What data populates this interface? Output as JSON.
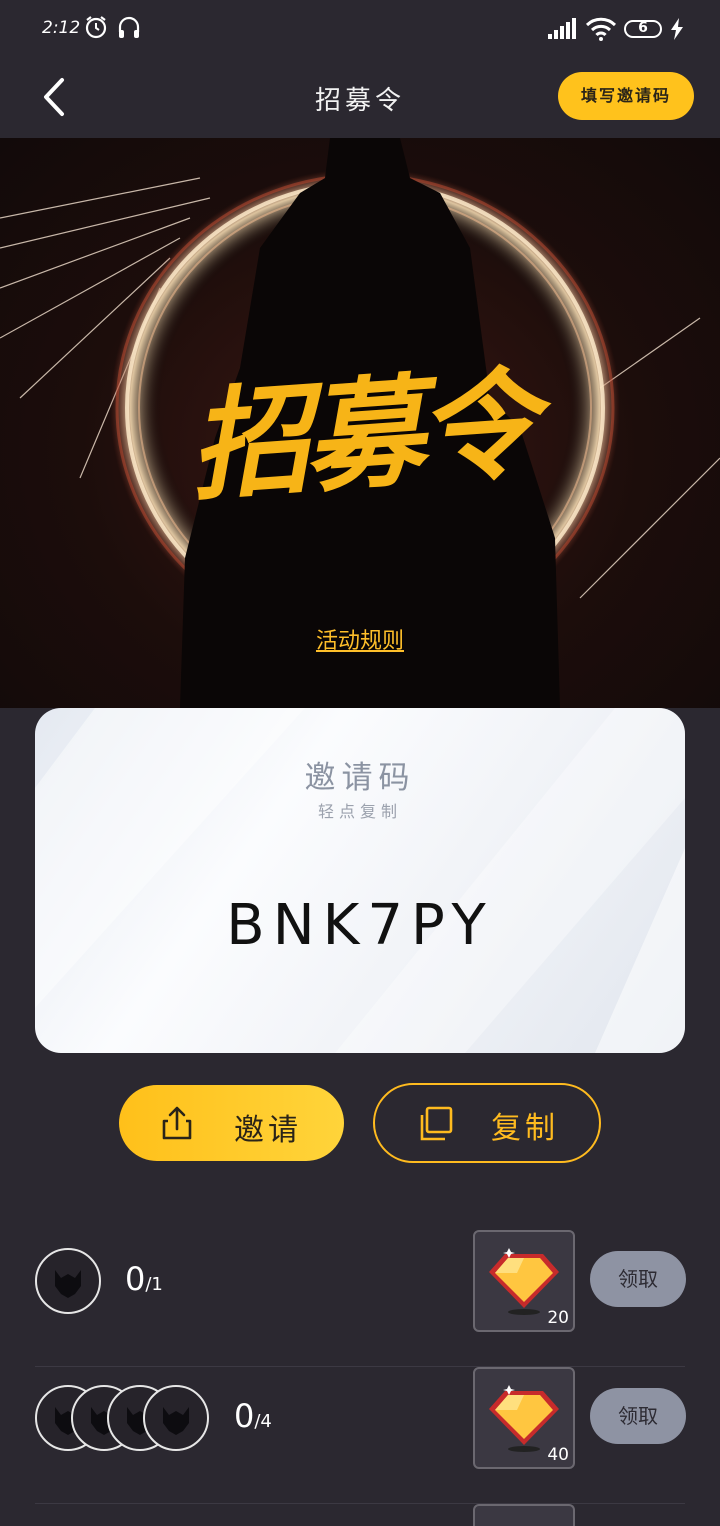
{
  "status_bar": {
    "time": "2:12",
    "battery": "6"
  },
  "header": {
    "title": "招募令",
    "invite_code_button": "填写邀请码"
  },
  "hero": {
    "banner_text": "招募令",
    "rules_link": "活动规则"
  },
  "invite_card": {
    "title": "邀请码",
    "subtitle": "轻点复制",
    "code": "BNK7PY"
  },
  "actions": {
    "invite_label": "邀请",
    "copy_label": "复制"
  },
  "rewards": [
    {
      "progress": "0",
      "target": "/1",
      "reward_amount": "20",
      "claim_label": "领取",
      "avatars": 1
    },
    {
      "progress": "0",
      "target": "/4",
      "reward_amount": "40",
      "claim_label": "领取",
      "avatars": 4
    }
  ],
  "colors": {
    "accent": "#ffc21c",
    "background": "#2b2830",
    "claim_button": "#8e93a3"
  }
}
